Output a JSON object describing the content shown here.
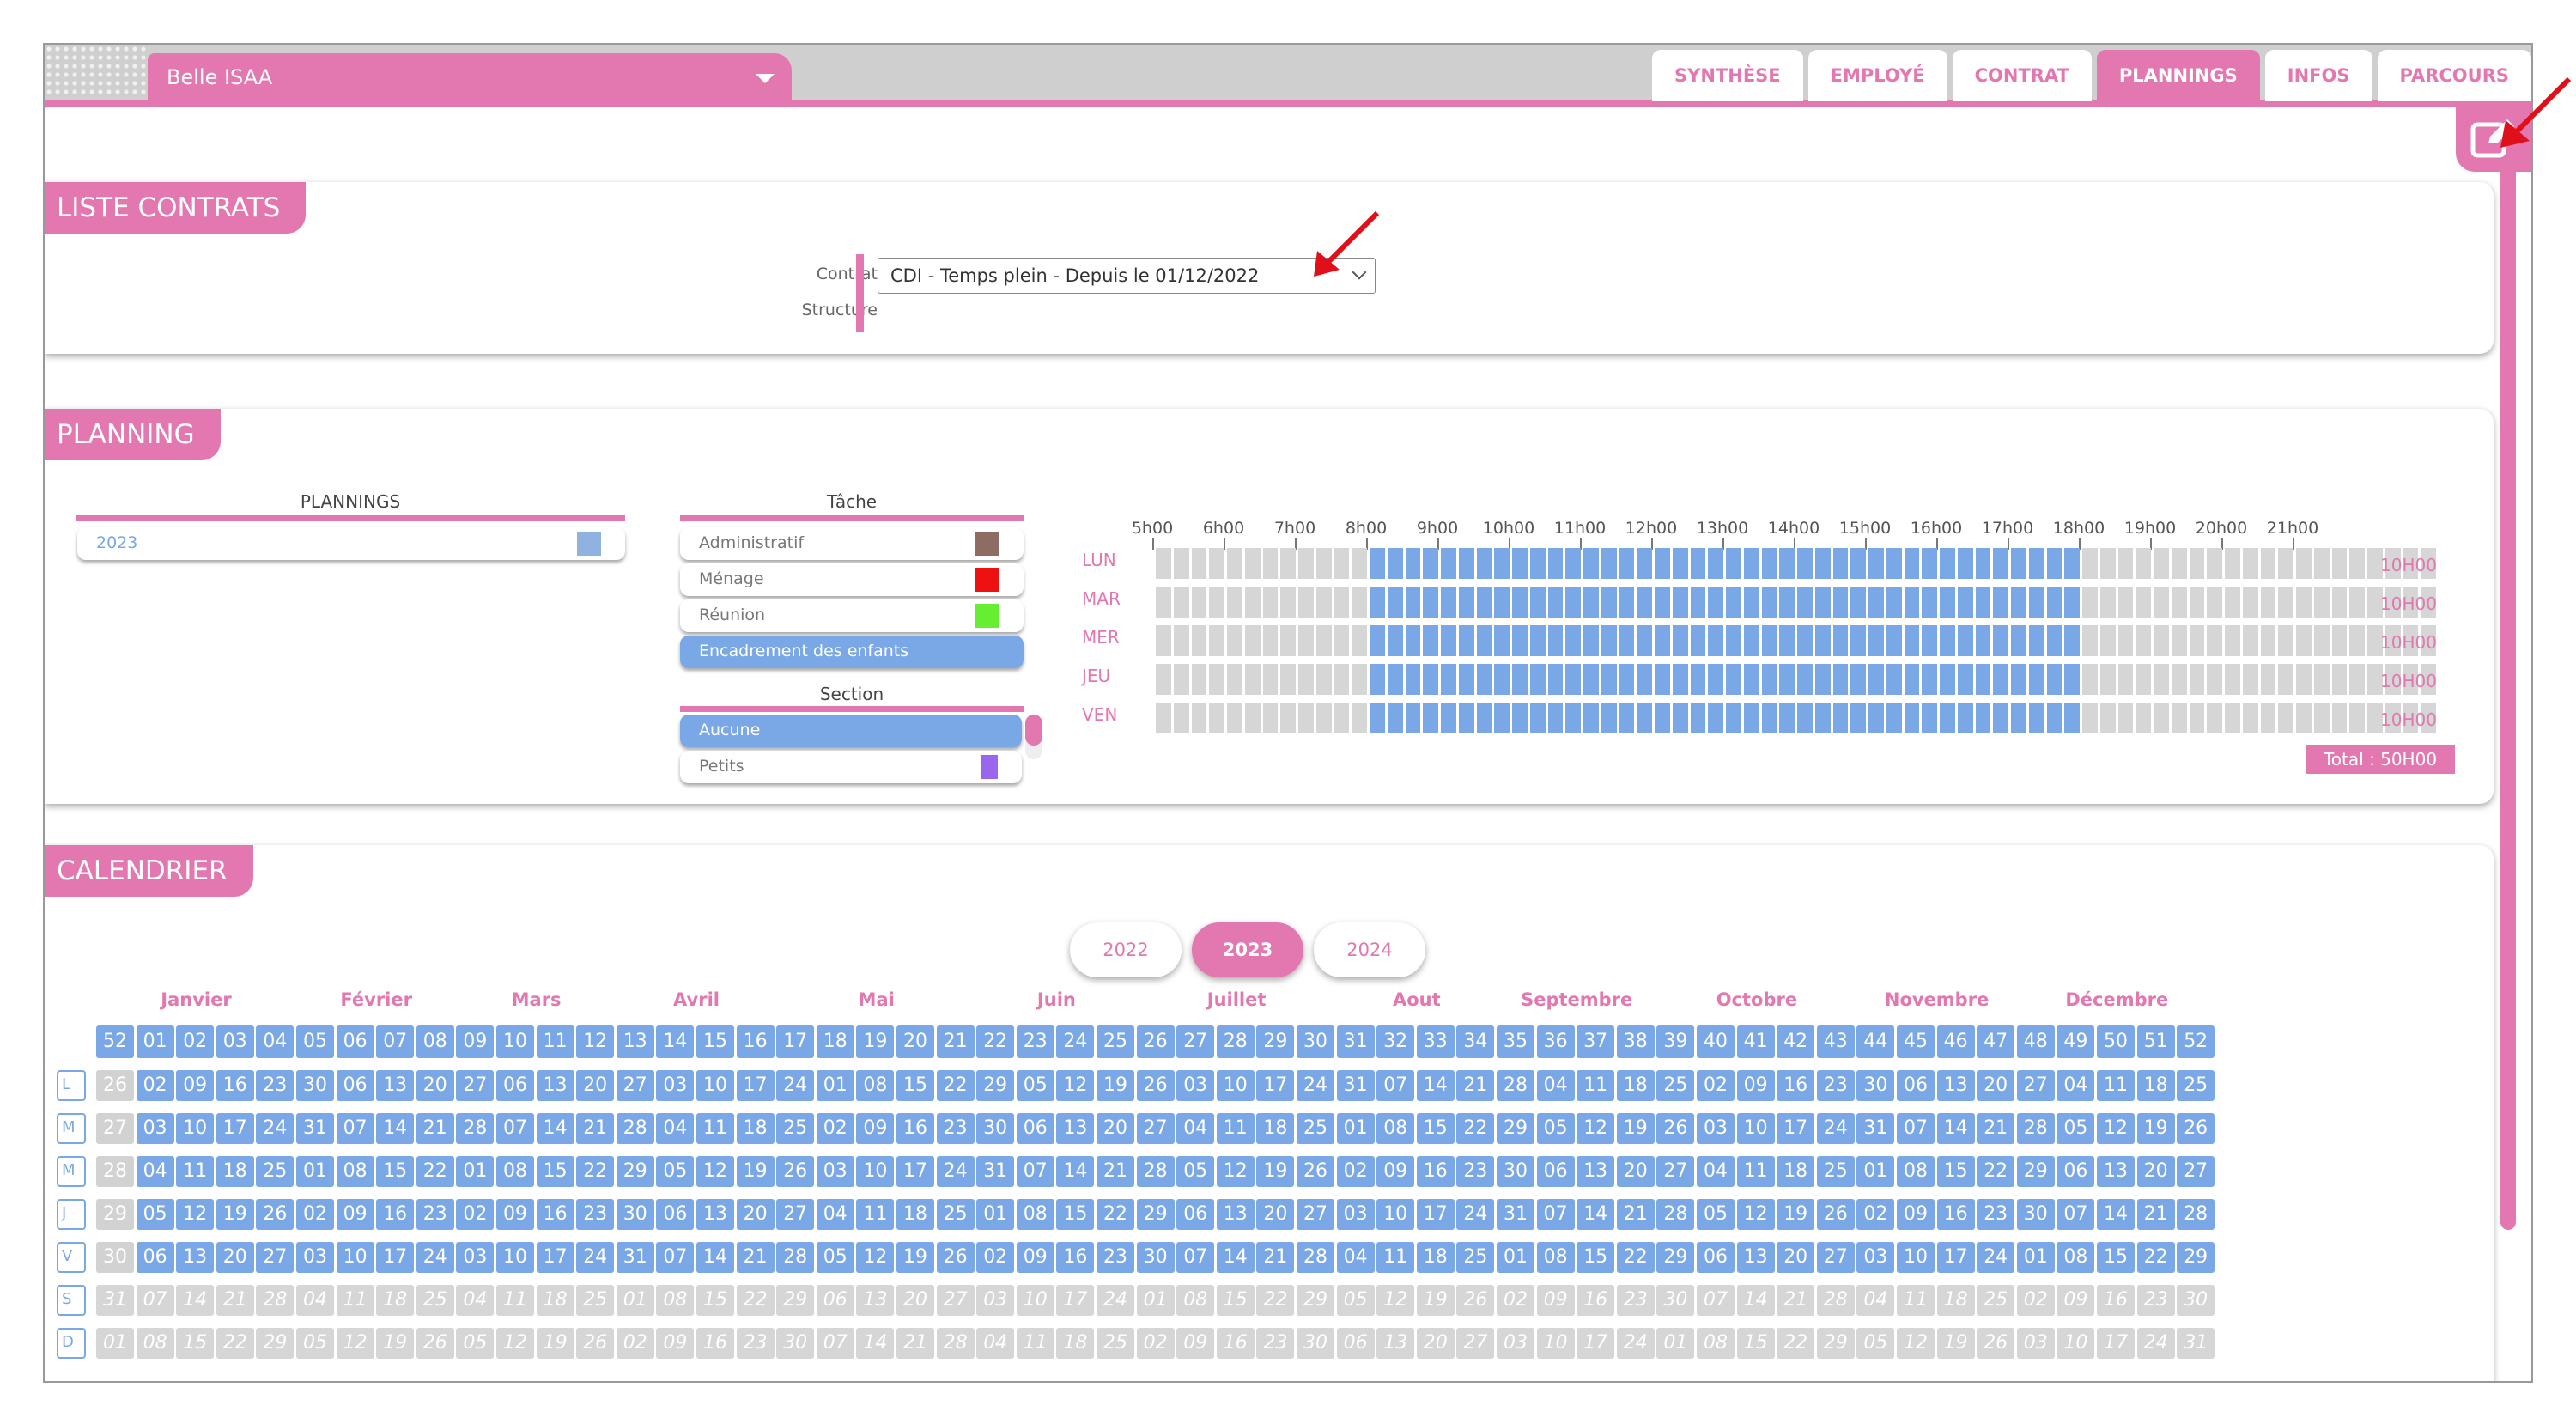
{
  "header": {
    "employee_name": "Belle ISAA",
    "tabs": [
      {
        "label": "SYNTHÈSE",
        "active": false
      },
      {
        "label": "EMPLOYÉ",
        "active": false
      },
      {
        "label": "CONTRAT",
        "active": false
      },
      {
        "label": "PLANNINGS",
        "active": true
      },
      {
        "label": "INFOS",
        "active": false
      },
      {
        "label": "PARCOURS",
        "active": false
      }
    ],
    "edit_icon": "edit-icon"
  },
  "colors": {
    "accent": "#e377b0",
    "blue": "#7aa7e6",
    "grey": "#d2d2d2",
    "arrow": "#e0101a"
  },
  "contracts": {
    "title": "LISTE CONTRATS",
    "contract_label": "Contrat",
    "structure_label": "Structure",
    "contract_value": "CDI - Temps plein - Depuis le 01/12/2022"
  },
  "planning": {
    "title": "PLANNING",
    "plannings_header": "PLANNINGS",
    "plannings": [
      {
        "label": "2023",
        "color": "#8fb2e0"
      }
    ],
    "task_header": "Tâche",
    "tasks": [
      {
        "label": "Administratif",
        "color": "#8c6c63",
        "selected": false
      },
      {
        "label": "Ménage",
        "color": "#ee1111",
        "selected": false
      },
      {
        "label": "Réunion",
        "color": "#66ee33",
        "selected": false
      },
      {
        "label": "Encadrement des enfants",
        "color": "",
        "selected": true
      }
    ],
    "section_header": "Section",
    "sections": [
      {
        "label": "Aucune",
        "color": "",
        "selected": true
      },
      {
        "label": "Petits",
        "color": "#9966ee",
        "selected": false
      }
    ],
    "hours": [
      "5h00",
      "6h00",
      "7h00",
      "8h00",
      "9h00",
      "10h00",
      "11h00",
      "12h00",
      "13h00",
      "14h00",
      "15h00",
      "16h00",
      "17h00",
      "18h00",
      "19h00",
      "20h00",
      "21h00"
    ],
    "days": [
      {
        "label": "LUN",
        "total": "10H00",
        "start": 8,
        "end": 18
      },
      {
        "label": "MAR",
        "total": "10H00",
        "start": 8,
        "end": 18
      },
      {
        "label": "MER",
        "total": "10H00",
        "start": 8,
        "end": 18
      },
      {
        "label": "JEU",
        "total": "10H00",
        "start": 8,
        "end": 18
      },
      {
        "label": "VEN",
        "total": "10H00",
        "start": 8,
        "end": 18
      }
    ],
    "total_label": "Total : 50H00"
  },
  "calendar": {
    "title": "CALENDRIER",
    "years": [
      {
        "label": "2022",
        "active": false
      },
      {
        "label": "2023",
        "active": true
      },
      {
        "label": "2024",
        "active": false
      }
    ],
    "months": [
      "Janvier",
      "Février",
      "Mars",
      "Avril",
      "Mai",
      "Juin",
      "Juillet",
      "Aout",
      "Septembre",
      "Octobre",
      "Novembre",
      "Décembre"
    ],
    "weekday_letters": [
      "L",
      "M",
      "M",
      "J",
      "V",
      "S",
      "D"
    ]
  }
}
